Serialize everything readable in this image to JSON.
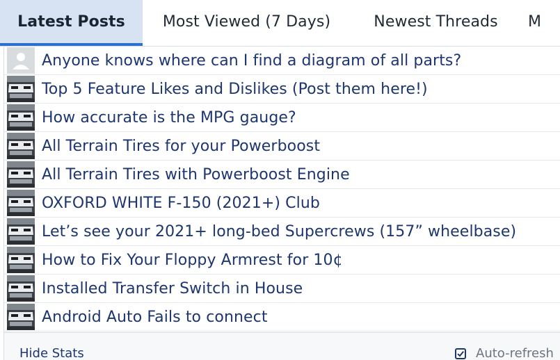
{
  "tabs": [
    {
      "label": "Latest Posts",
      "active": true
    },
    {
      "label": "Most Viewed (7 Days)",
      "active": false
    },
    {
      "label": "Newest Threads",
      "active": false
    },
    {
      "label": "M",
      "active": false
    }
  ],
  "posts": [
    {
      "title": "Anyone knows where can I find a diagram of all parts?",
      "avatar": "default-user-icon"
    },
    {
      "title": "Top 5 Feature Likes and Dislikes (Post them here!)",
      "avatar": "truck-thumbnail"
    },
    {
      "title": "How accurate is the MPG gauge?",
      "avatar": "truck-thumbnail"
    },
    {
      "title": "All Terrain Tires for your Powerboost",
      "avatar": "truck-thumbnail"
    },
    {
      "title": "All Terrain Tires with Powerboost Engine",
      "avatar": "truck-thumbnail"
    },
    {
      "title": "OXFORD WHITE F-150 (2021+) Club",
      "avatar": "truck-thumbnail"
    },
    {
      "title": "Let’s see your 2021+ long-bed Supercrews (157” wheelbase)",
      "avatar": "truck-thumbnail"
    },
    {
      "title": "How to Fix Your Floppy Armrest for 10¢",
      "avatar": "truck-thumbnail"
    },
    {
      "title": "Installed Transfer Switch in House",
      "avatar": "truck-thumbnail"
    },
    {
      "title": "Android Auto Fails to connect",
      "avatar": "truck-thumbnail"
    }
  ],
  "footer": {
    "hide_stats_label": "Hide Stats",
    "auto_refresh_label": "Auto-refresh",
    "auto_refresh_checked": true
  },
  "colors": {
    "accent": "#2f6fd0",
    "active_tab_bg": "#d7e3f3",
    "link": "#1d3670"
  }
}
